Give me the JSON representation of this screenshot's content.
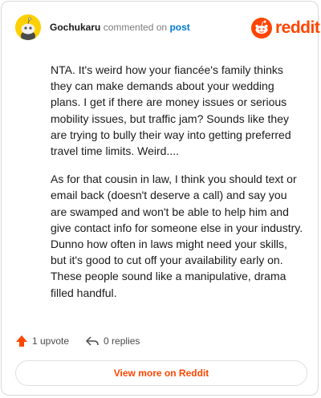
{
  "comment": {
    "username": "Gochukaru",
    "action": "commented on",
    "link": "post",
    "brand": "reddit",
    "paragraphs": [
      "NTA. It's weird how your fiancée's family thinks they can make demands about your wedding plans. I get if there are money issues or serious mobility issues, but traffic jam? Sounds like they are trying to bully their way into getting preferred travel time limits. Weird....",
      "As for that cousin in law, I think you should text or email back (doesn't deserve a call) and say you are swamped and won't be able to help him and give contact info for someone else in your industry. Dunno how often in laws might need your skills, but it's good to cut off your availability early on. These people sound like a manipulative, drama filled handful."
    ]
  },
  "actions": {
    "upvote_label": "1 upvote",
    "replies_label": "0 replies"
  },
  "footer": {
    "view_more_label": "View more on Reddit"
  },
  "colors": {
    "accent": "#ff4500",
    "link": "#0079d3",
    "avatar": "#ffd000"
  },
  "icons": [
    "snoo-avatar-icon",
    "reddit-logo-icon",
    "upvote-arrow-icon",
    "reply-icon"
  ]
}
